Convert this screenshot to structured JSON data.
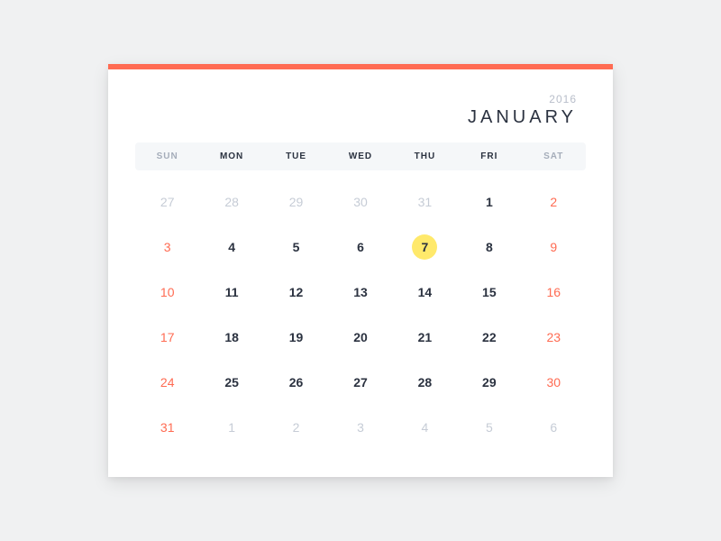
{
  "header": {
    "year": "2016",
    "month": "JANUARY"
  },
  "weekdays": [
    {
      "label": "SUN",
      "weekend": true
    },
    {
      "label": "MON",
      "weekend": false
    },
    {
      "label": "TUE",
      "weekend": false
    },
    {
      "label": "WED",
      "weekend": false
    },
    {
      "label": "THU",
      "weekend": false
    },
    {
      "label": "FRI",
      "weekend": false
    },
    {
      "label": "SAT",
      "weekend": true
    }
  ],
  "weeks": [
    [
      {
        "d": "27",
        "k": "other"
      },
      {
        "d": "28",
        "k": "other"
      },
      {
        "d": "29",
        "k": "other"
      },
      {
        "d": "30",
        "k": "other"
      },
      {
        "d": "31",
        "k": "other"
      },
      {
        "d": "1",
        "k": "current"
      },
      {
        "d": "2",
        "k": "weekend"
      }
    ],
    [
      {
        "d": "3",
        "k": "weekend"
      },
      {
        "d": "4",
        "k": "current"
      },
      {
        "d": "5",
        "k": "current"
      },
      {
        "d": "6",
        "k": "current"
      },
      {
        "d": "7",
        "k": "today"
      },
      {
        "d": "8",
        "k": "current"
      },
      {
        "d": "9",
        "k": "weekend"
      }
    ],
    [
      {
        "d": "10",
        "k": "weekend"
      },
      {
        "d": "11",
        "k": "current"
      },
      {
        "d": "12",
        "k": "current"
      },
      {
        "d": "13",
        "k": "current"
      },
      {
        "d": "14",
        "k": "current"
      },
      {
        "d": "15",
        "k": "current"
      },
      {
        "d": "16",
        "k": "weekend"
      }
    ],
    [
      {
        "d": "17",
        "k": "weekend"
      },
      {
        "d": "18",
        "k": "current"
      },
      {
        "d": "19",
        "k": "current"
      },
      {
        "d": "20",
        "k": "current"
      },
      {
        "d": "21",
        "k": "current"
      },
      {
        "d": "22",
        "k": "current"
      },
      {
        "d": "23",
        "k": "weekend"
      }
    ],
    [
      {
        "d": "24",
        "k": "weekend"
      },
      {
        "d": "25",
        "k": "current"
      },
      {
        "d": "26",
        "k": "current"
      },
      {
        "d": "27",
        "k": "current"
      },
      {
        "d": "28",
        "k": "current"
      },
      {
        "d": "29",
        "k": "current"
      },
      {
        "d": "30",
        "k": "weekend"
      }
    ],
    [
      {
        "d": "31",
        "k": "weekend"
      },
      {
        "d": "1",
        "k": "other"
      },
      {
        "d": "2",
        "k": "other"
      },
      {
        "d": "3",
        "k": "other"
      },
      {
        "d": "4",
        "k": "other"
      },
      {
        "d": "5",
        "k": "other"
      },
      {
        "d": "6",
        "k": "other"
      }
    ]
  ]
}
